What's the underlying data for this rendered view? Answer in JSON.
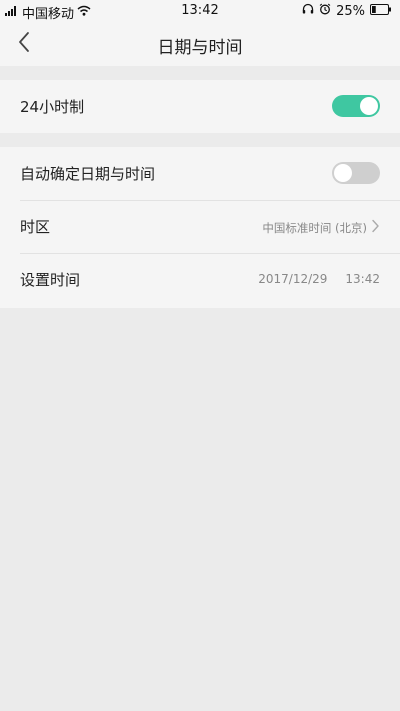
{
  "status_bar": {
    "signal_icon": "signal-icon",
    "carrier": "中国移动",
    "wifi_icon": "wifi-icon",
    "time": "13:42",
    "headset_icon": "headset-icon",
    "alarm_icon": "alarm-icon",
    "battery_percent": "25%",
    "battery_icon": "battery-icon",
    "battery_level": 0.25
  },
  "header": {
    "back_icon": "chevron-left-icon",
    "title": "日期与时间"
  },
  "settings": {
    "clock_24h": {
      "label": "24小时制",
      "enabled": true
    },
    "auto_datetime": {
      "label": "自动确定日期与时间",
      "enabled": false
    },
    "timezone": {
      "label": "时区",
      "value": "中国标准时间 (北京)",
      "chevron_icon": "chevron-right-icon"
    },
    "set_time": {
      "label": "设置时间",
      "date": "2017/12/29",
      "time": "13:42"
    }
  },
  "colors": {
    "toggle_on": "#3fc7a1",
    "toggle_off": "#cfcfcf",
    "background": "#ebebeb",
    "card": "#f5f5f5"
  }
}
